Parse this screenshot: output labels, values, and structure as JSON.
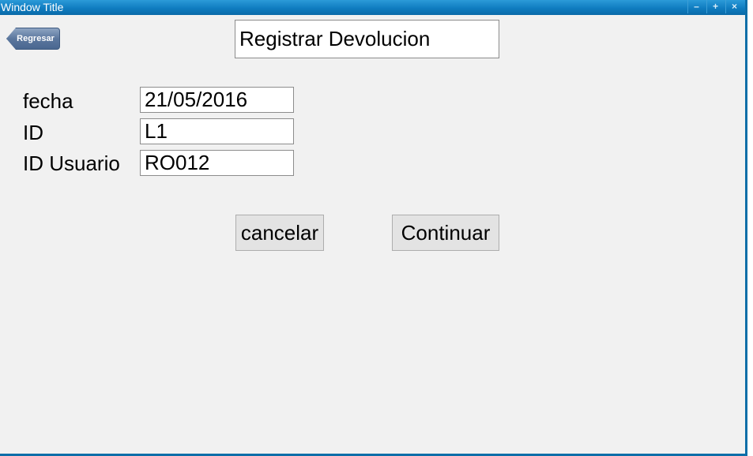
{
  "window": {
    "title": "Window Title",
    "controls": {
      "minimize": "–",
      "maximize": "+",
      "close": "×"
    }
  },
  "nav": {
    "back_label": "Regresar"
  },
  "header": {
    "title": "Registrar Devolucion"
  },
  "form": {
    "fields": [
      {
        "label": "fecha",
        "value": "21/05/2016"
      },
      {
        "label": "ID",
        "value": "L1"
      },
      {
        "label": "ID Usuario",
        "value": "RO012"
      }
    ]
  },
  "actions": {
    "cancel_label": "cancelar",
    "continue_label": "Continuar"
  }
}
